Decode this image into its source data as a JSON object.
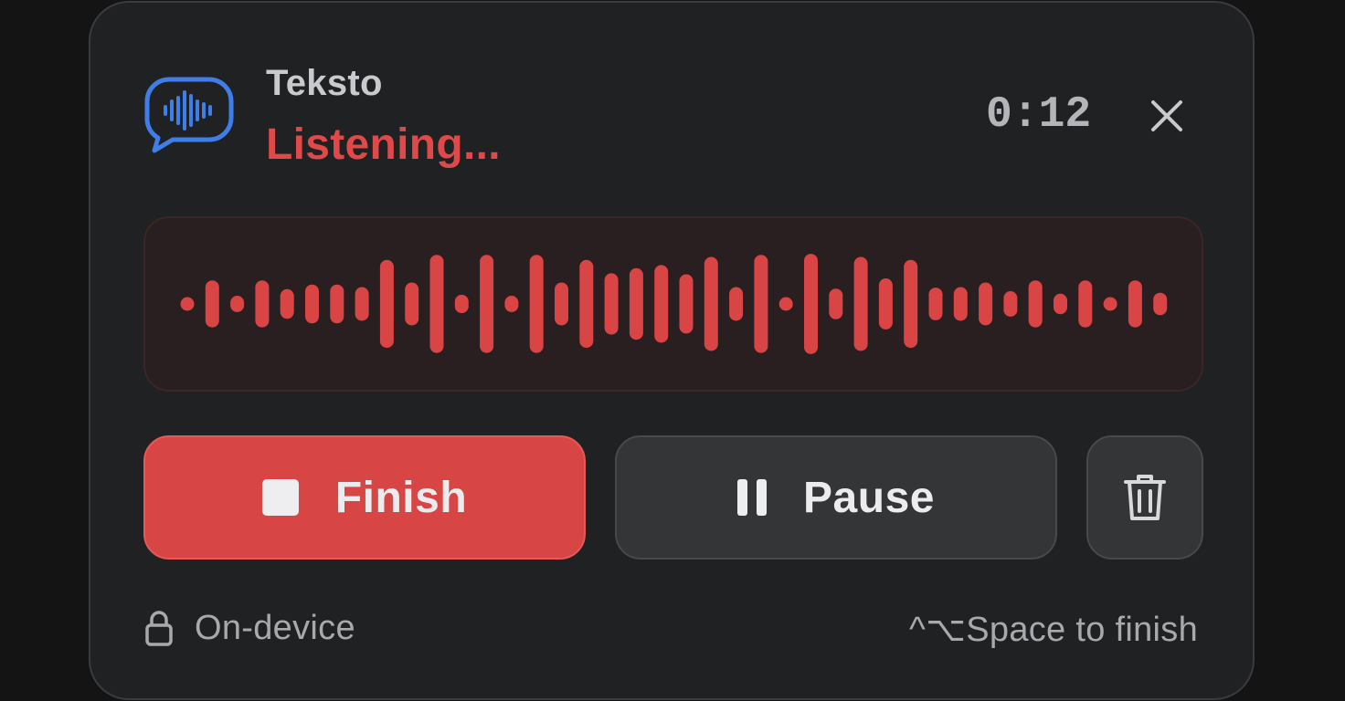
{
  "header": {
    "app_name": "Teksto",
    "status": "Listening...",
    "timer": "0:12",
    "app_icon": "speech-bubble-waveform-icon",
    "close_icon": "close-icon"
  },
  "waveform": {
    "color": "#d94444",
    "levels": [
      0.12,
      0.46,
      0.16,
      0.46,
      0.29,
      0.38,
      0.38,
      0.33,
      0.86,
      0.42,
      0.96,
      0.18,
      0.96,
      0.16,
      0.96,
      0.42,
      0.86,
      0.6,
      0.7,
      0.76,
      0.58,
      0.92,
      0.33,
      0.96,
      0.12,
      0.98,
      0.3,
      0.92,
      0.5,
      0.86,
      0.32,
      0.33,
      0.42,
      0.25,
      0.46,
      0.2,
      0.46,
      0.12,
      0.46,
      0.22
    ]
  },
  "buttons": {
    "finish_label": "Finish",
    "pause_label": "Pause",
    "finish_icon": "stop-icon",
    "pause_icon": "pause-icon",
    "delete_icon": "trash-icon"
  },
  "footer": {
    "privacy_label": "On-device",
    "privacy_icon": "lock-icon",
    "shortcut_hint": "^⌥Space to finish"
  },
  "colors": {
    "accent": "#d74645",
    "status": "#e0494a",
    "icon_blue": "#3f7ee8"
  }
}
